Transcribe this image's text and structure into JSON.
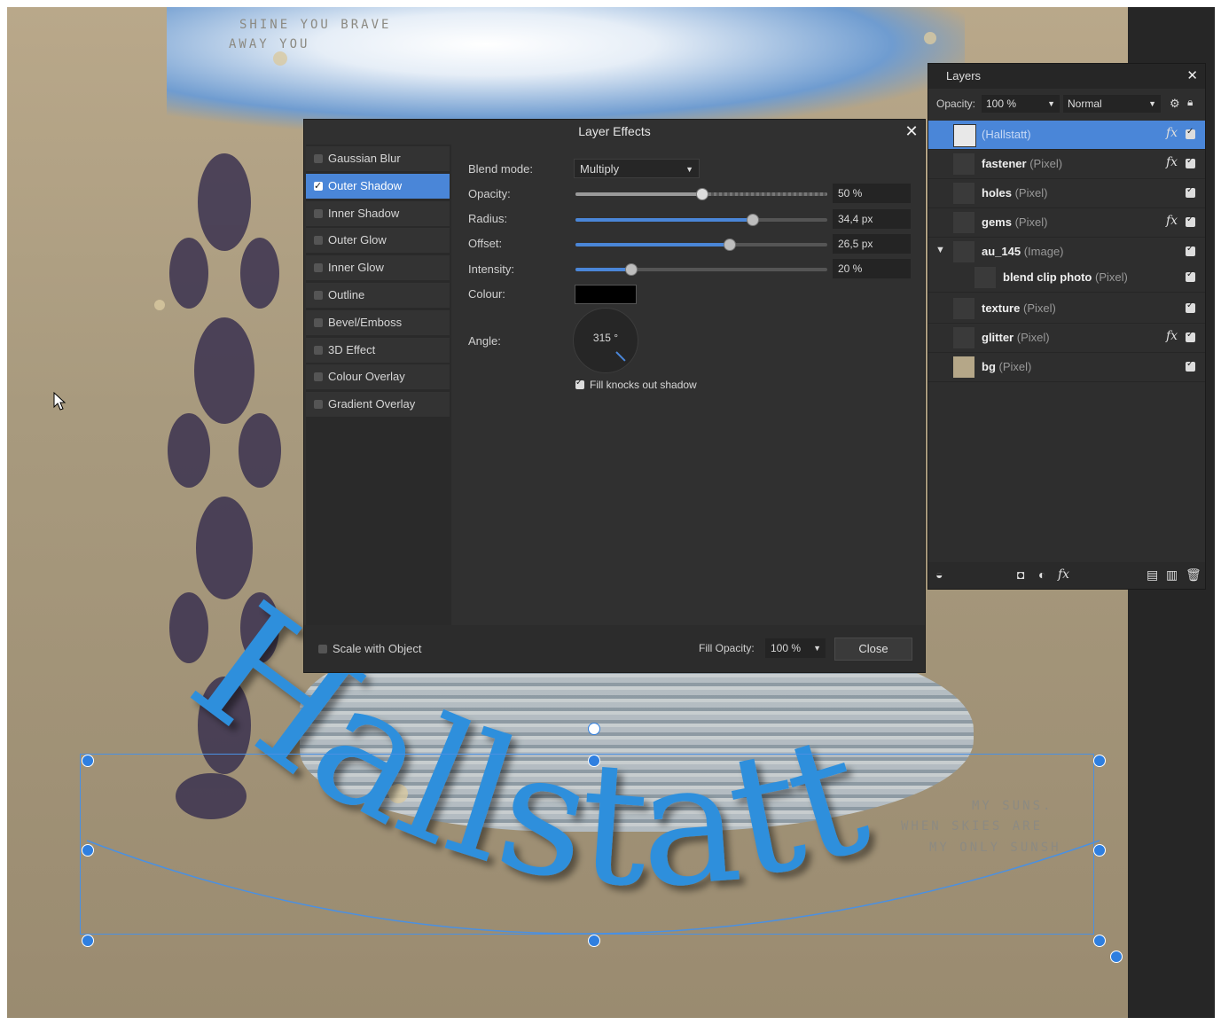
{
  "canvas": {
    "text_art": "Hallstatt",
    "bg_text_top_1": "SHINE YOU BRAVE",
    "bg_text_top_2": "AWAY YOU",
    "bg_text_right_1": "MY SUNS.",
    "bg_text_right_2": "WHEN SKIES ARE",
    "bg_text_right_3": "MY ONLY SUNSH",
    "accent_color": "#2f8fdc"
  },
  "dialog": {
    "title": "Layer Effects",
    "close_icon": "close-icon",
    "effects": [
      {
        "label": "Gaussian Blur",
        "checked": false,
        "active": false
      },
      {
        "label": "Outer Shadow",
        "checked": true,
        "active": true
      },
      {
        "label": "Inner Shadow",
        "checked": false,
        "active": false
      },
      {
        "label": "Outer Glow",
        "checked": false,
        "active": false
      },
      {
        "label": "Inner Glow",
        "checked": false,
        "active": false
      },
      {
        "label": "Outline",
        "checked": false,
        "active": false
      },
      {
        "label": "Bevel/Emboss",
        "checked": false,
        "active": false
      },
      {
        "label": "3D Effect",
        "checked": false,
        "active": false
      },
      {
        "label": "Colour Overlay",
        "checked": false,
        "active": false
      },
      {
        "label": "Gradient Overlay",
        "checked": false,
        "active": false
      }
    ],
    "blend_mode_label": "Blend mode:",
    "blend_mode_value": "Multiply",
    "opacity_label": "Opacity:",
    "opacity_value": "50 %",
    "opacity_level": 0.5,
    "radius_label": "Radius:",
    "radius_value": "34,4 px",
    "radius_level": 0.7,
    "offset_label": "Offset:",
    "offset_value": "26,5 px",
    "offset_level": 0.61,
    "intensity_label": "Intensity:",
    "intensity_value": "20 %",
    "intensity_level": 0.22,
    "colour_label": "Colour:",
    "colour_value": "#000000",
    "angle_label": "Angle:",
    "angle_value": "315 °",
    "fill_knocks_label": "Fill knocks out shadow",
    "scale_with_object_label": "Scale with Object",
    "fill_opacity_label": "Fill Opacity:",
    "fill_opacity_value": "100 %",
    "close_button_label": "Close"
  },
  "layers_panel": {
    "tab_label": "Layers",
    "opacity_label": "Opacity:",
    "opacity_value": "100 %",
    "blend_value": "Normal",
    "layers": [
      {
        "name": "(Hallstatt)",
        "type": "",
        "selected": true,
        "fx": true,
        "indent": 0
      },
      {
        "name": "fastener",
        "type": "(Pixel)",
        "selected": false,
        "fx": true,
        "indent": 0
      },
      {
        "name": "holes",
        "type": "(Pixel)",
        "selected": false,
        "fx": false,
        "indent": 0
      },
      {
        "name": "gems",
        "type": "(Pixel)",
        "selected": false,
        "fx": true,
        "indent": 0
      },
      {
        "name": "au_145",
        "type": "(Image)",
        "selected": false,
        "fx": false,
        "indent": 0,
        "expanded": true
      },
      {
        "name": "blend clip photo",
        "type": "(Pixel)",
        "selected": false,
        "fx": false,
        "indent": 1
      },
      {
        "name": "texture",
        "type": "(Pixel)",
        "selected": false,
        "fx": false,
        "indent": 0
      },
      {
        "name": "glitter",
        "type": "(Pixel)",
        "selected": false,
        "fx": true,
        "indent": 0
      },
      {
        "name": "bg",
        "type": "(Pixel)",
        "selected": false,
        "fx": false,
        "indent": 0
      }
    ],
    "fx_label": "fx"
  }
}
